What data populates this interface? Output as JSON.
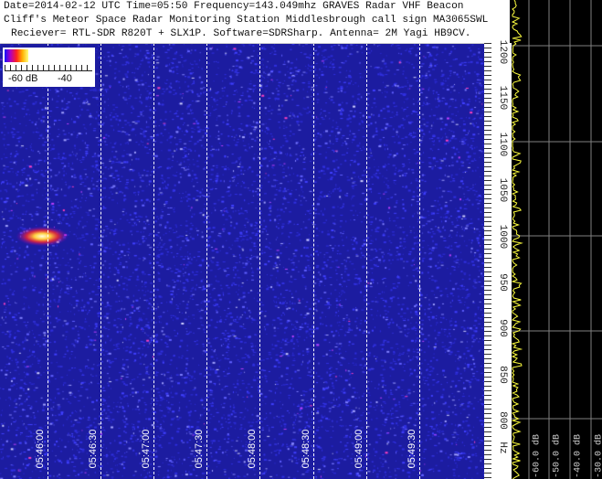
{
  "header": {
    "line1": "Date=2014-02-12 UTC Time=05:50 Frequency=143.049mhz GRAVES Radar VHF Beacon",
    "line2": "Cliff's Meteor Space Radar Monitoring Station Middlesbrough call sign MA3065SWL",
    "line3": "Reciever= RTL-SDR R820T + SLX1P. Software=SDRSharp. Antenna= 2M Yagi HB9CV."
  },
  "legend": {
    "min_label": "-60 dB",
    "max_label": "-40"
  },
  "chart_data": {
    "type": "heatmap",
    "title": "Spectrogram (waterfall) of GRAVES radar meteor echoes",
    "x_ticks": [
      "05:46:00",
      "05:46:30",
      "05:47:00",
      "05:47:30",
      "05:48:00",
      "05:48:30",
      "05:49:00",
      "05:49:30"
    ],
    "y_ticks": [
      "1200",
      "1150",
      "1100",
      "1050",
      "1000",
      "950",
      "900",
      "850",
      "800"
    ],
    "y_unit": "Hz",
    "ylim": [
      770,
      1210
    ],
    "color_scale_db": [
      -60,
      -40
    ],
    "events": [
      {
        "time": "05:45:57",
        "frequency_hz": 1000,
        "type": "meteor echo"
      }
    ],
    "spectrum_panel": {
      "db_ticks": [
        "-60.0 dB",
        "-50.0 dB",
        "-40.0 dB",
        "-30.0 dB"
      ]
    }
  },
  "colors": {
    "background": "#1c1ca0",
    "trace": "#ffff40",
    "grid": "#808080"
  }
}
